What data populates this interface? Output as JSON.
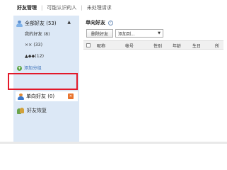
{
  "topnav": {
    "items": [
      "好友管理",
      "可能认识的人",
      "未处理请求"
    ],
    "separator": "|"
  },
  "sidebar": {
    "group_header": "全部好友 (53)",
    "collapse_glyph": "▲",
    "items": [
      "我的好友 (8)",
      "×× (33)",
      "▲◆◆(12)"
    ],
    "add_group": "添加分组",
    "oneway": "单向好友 (0)",
    "oneway_badge": "✕",
    "blacklist": "好友恢复"
  },
  "main": {
    "title": "单向好友",
    "help_glyph": "?",
    "delete_button": "删除好友",
    "add_select": "添加到...",
    "add_select_caret": "▼",
    "columns": [
      "昵称",
      "帐号",
      "性别",
      "年龄",
      "生日",
      "所"
    ]
  },
  "colors": {
    "sidebar_bg": "#dce8f6",
    "highlight": "#e3192a",
    "link": "#3a6fb8"
  }
}
